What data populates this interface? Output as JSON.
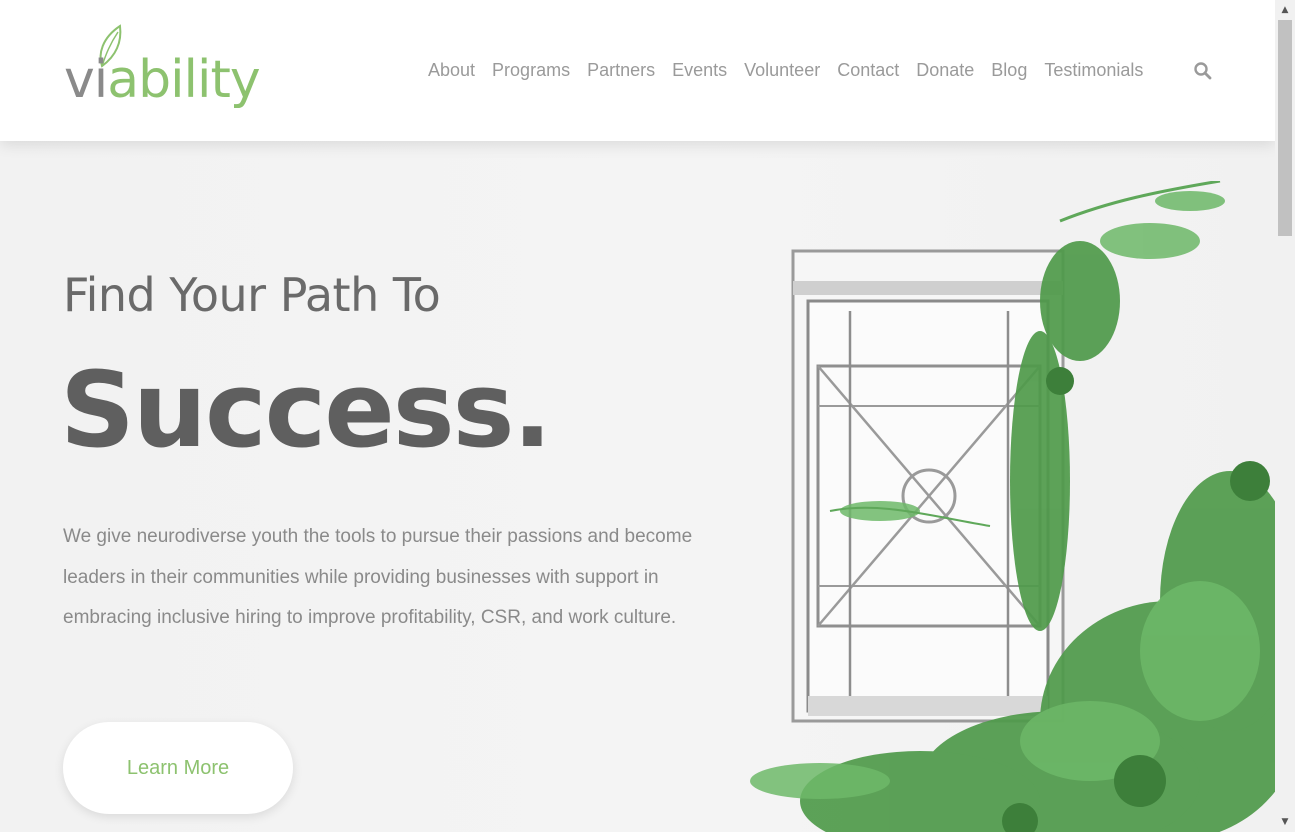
{
  "header": {
    "logo": {
      "part1": "vi",
      "part2": "ability",
      "alt": "viability"
    },
    "nav": [
      "About",
      "Programs",
      "Partners",
      "Events",
      "Volunteer",
      "Contact",
      "Donate",
      "Blog",
      "Testimonials"
    ],
    "search_icon": "search-icon"
  },
  "hero": {
    "subtitle": "Find Your Path To",
    "title": "Success.",
    "description": "We give neurodiverse youth the tools to pursue their passions and become leaders in their communities while providing businesses with support in embracing inclusive hiring to improve profitability, CSR, and work culture.",
    "cta_label": "Learn More",
    "image_icon": "window-with-ivy-photo"
  },
  "colors": {
    "brand_green": "#8dc26f",
    "logo_gray": "#8a8a8a",
    "heading_gray": "#5f5f5f",
    "text_gray": "#8a8a8a"
  },
  "scrollbar": {
    "up": "▲",
    "down": "▼"
  }
}
